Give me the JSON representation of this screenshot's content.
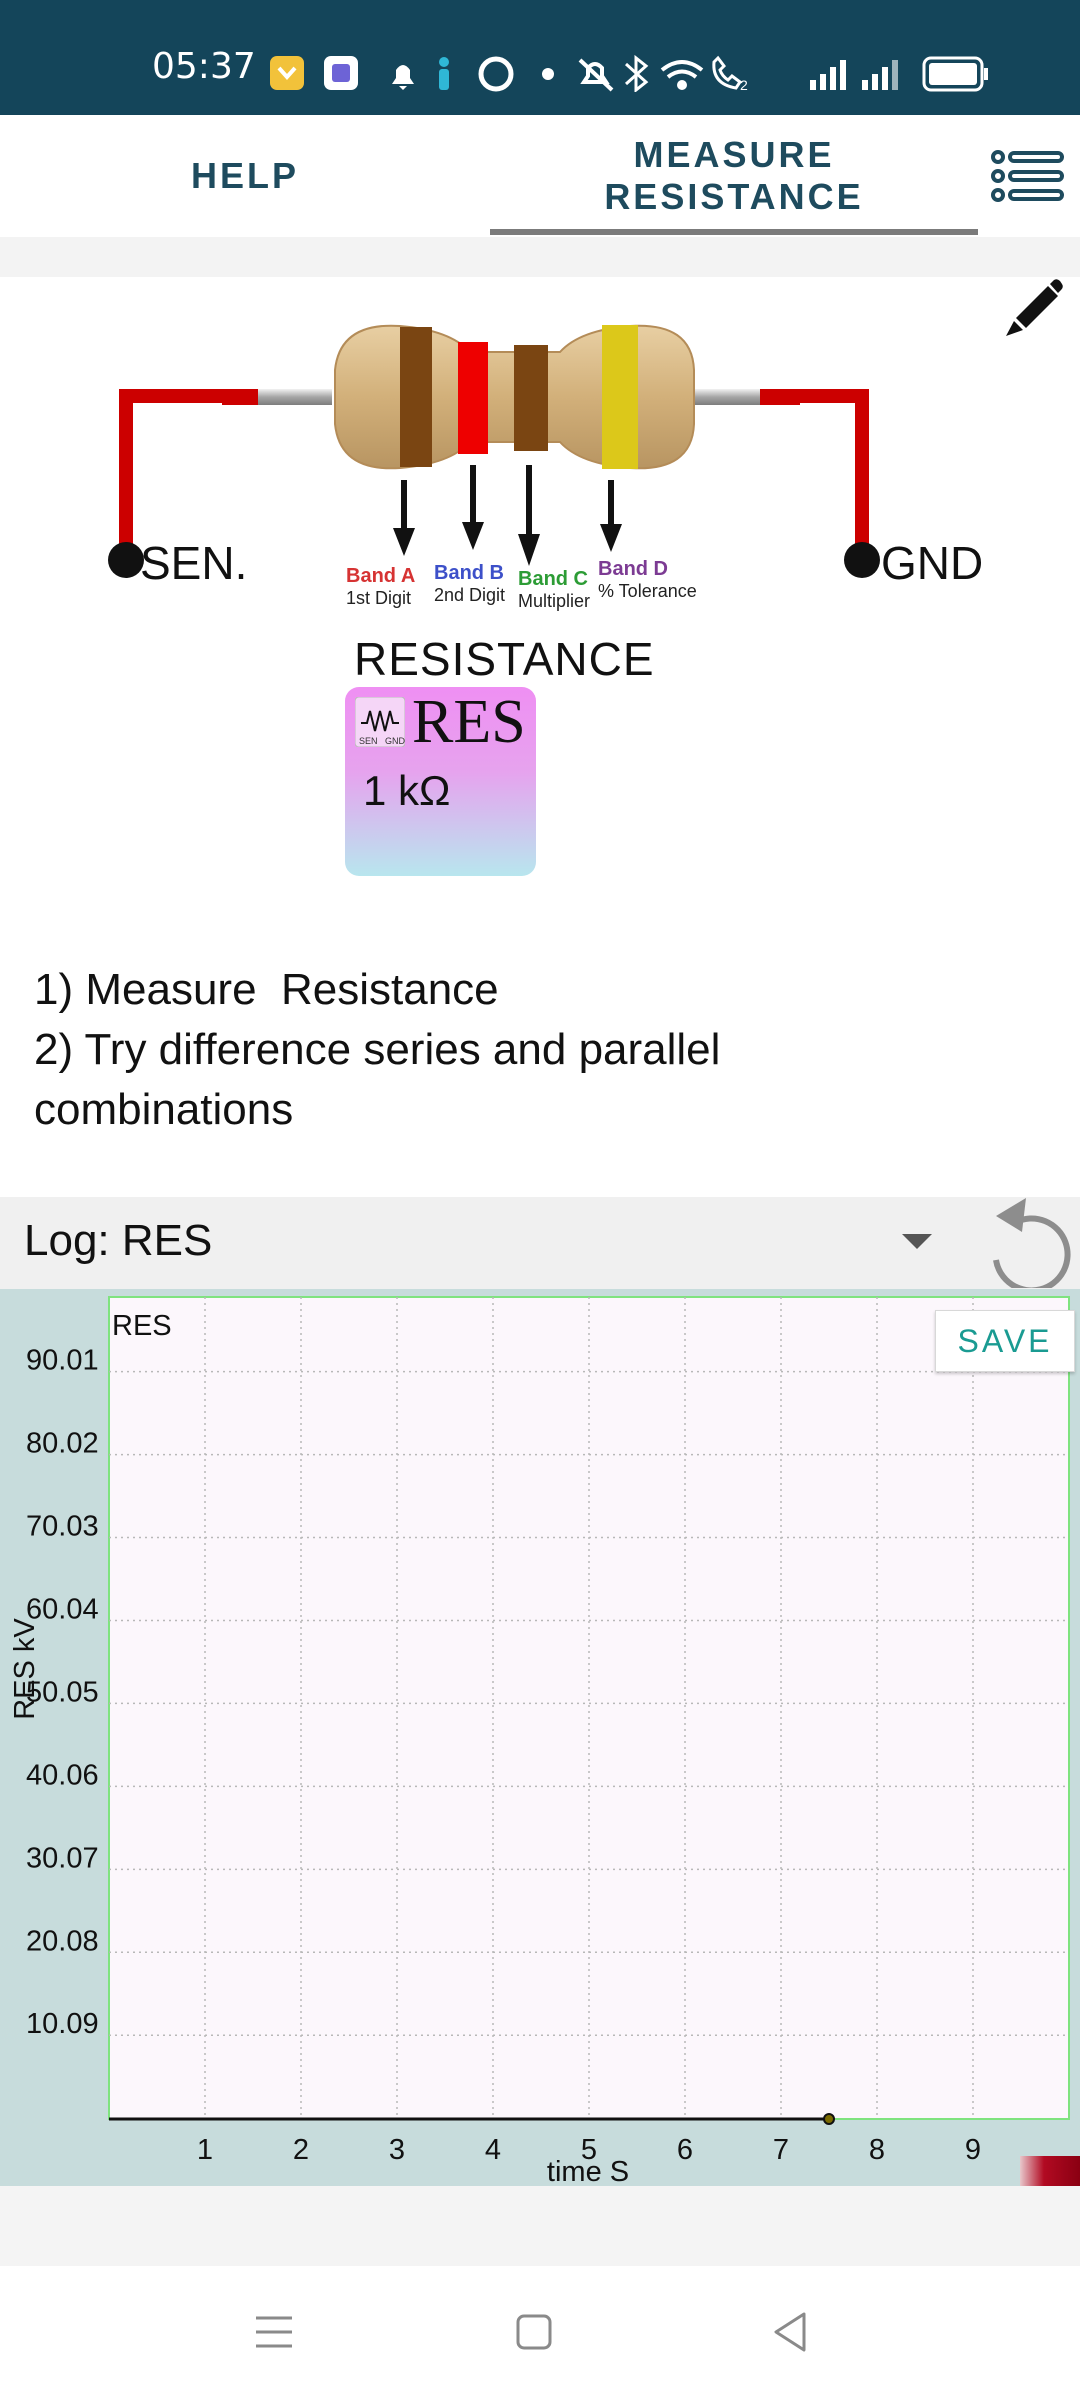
{
  "status_bar": {
    "time": "05:37",
    "icons": [
      "folder-badge-icon",
      "app-badge-icon",
      "bell-icon",
      "person-icon",
      "circle-app-icon",
      "dot-icon",
      "mute-icon",
      "bluetooth-icon",
      "wifi-icon",
      "wifi-call-icon",
      "signal-icon",
      "signal-icon-2",
      "battery-icon"
    ]
  },
  "tabs": {
    "help": "HELP",
    "measure_line1": "MEASURE",
    "measure_line2": "RESISTANCE",
    "selected": "measure"
  },
  "toolbar": {
    "menu_icon": "list-menu-icon",
    "edit_icon": "pencil-icon"
  },
  "diagram": {
    "sen_label": "SEN.",
    "gnd_label": "GND",
    "bands": [
      {
        "title": "Band A",
        "subtitle": "1st Digit",
        "color": "#d63333"
      },
      {
        "title": "Band B",
        "subtitle": "2nd Digit",
        "color": "#3d50c9"
      },
      {
        "title": "Band C",
        "subtitle": "Multiplier",
        "color": "#2c9c35"
      },
      {
        "title": "Band D",
        "subtitle": "% Tolerance",
        "color": "#7c3b93"
      }
    ]
  },
  "resistance": {
    "label": "RESISTANCE",
    "tile_title": "RES",
    "tile_icon_labels": [
      "SEN",
      "GND"
    ],
    "value": "1 kΩ"
  },
  "instructions": [
    "1) Measure  Resistance",
    "2) Try difference series and parallel",
    "combinations"
  ],
  "log": {
    "label": "Log: RES",
    "dropdown_icon": "dropdown-caret-icon",
    "reset_icon": "undo-icon",
    "save_label": "SAVE"
  },
  "chart_data": {
    "type": "line",
    "series": [
      {
        "name": "RES",
        "x": [
          0,
          7.5
        ],
        "y": [
          0,
          0
        ]
      }
    ],
    "xlabel": "time S",
    "ylabel": "RES kV",
    "xlim": [
      0,
      10
    ],
    "ylim": [
      0,
      99
    ],
    "x_ticks": [
      "1",
      "2",
      "3",
      "4",
      "5",
      "6",
      "7",
      "8",
      "9"
    ],
    "y_ticks": [
      "90.01",
      "80.02",
      "70.03",
      "60.04",
      "50.05",
      "40.06",
      "30.07",
      "20.08",
      "10.09"
    ],
    "grid": true,
    "legend": "top-left"
  },
  "nav_bar": {
    "icons": [
      "recents-icon",
      "home-icon",
      "back-icon"
    ]
  }
}
